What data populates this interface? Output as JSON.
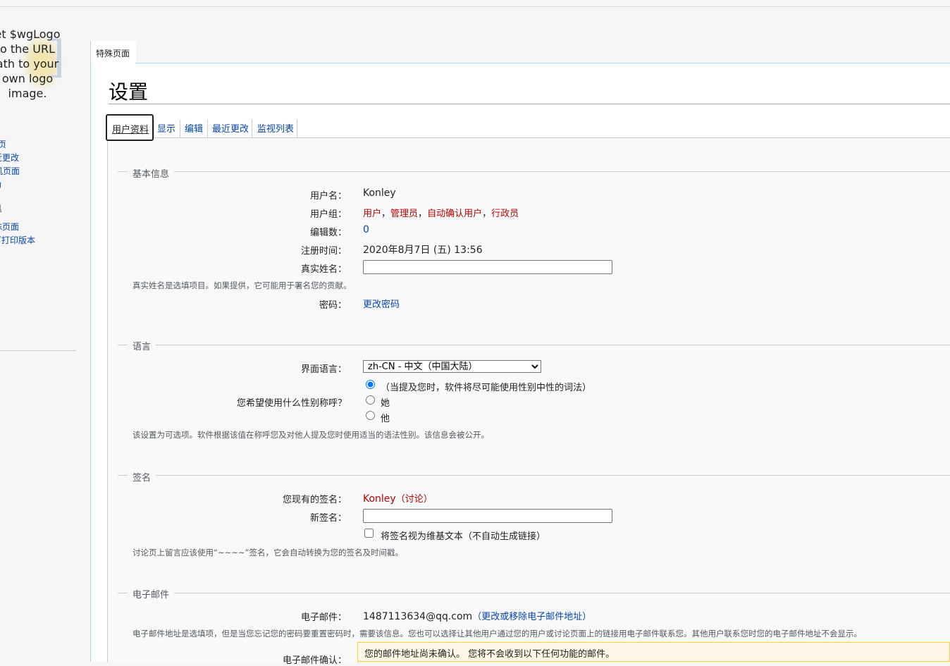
{
  "logo": {
    "text": "et $wgLogo\no the URL\nath to your\nown logo\nimage."
  },
  "sidebar": {
    "items": [
      {
        "label": "页"
      },
      {
        "label": "近更改"
      },
      {
        "label": "机页面"
      },
      {
        "label": "助"
      },
      {
        "label": "具"
      },
      {
        "label": "殊页面"
      },
      {
        "label": "可打印版本"
      }
    ]
  },
  "page_tab": {
    "label": "特殊页面"
  },
  "page": {
    "title": "设置"
  },
  "pref_tabs": [
    {
      "label": "用户资料",
      "selected": true
    },
    {
      "label": "显示"
    },
    {
      "label": "编辑"
    },
    {
      "label": "最近更改"
    },
    {
      "label": "监视列表"
    }
  ],
  "basic": {
    "legend": "基本信息",
    "username_label": "用户名：",
    "username": "Konley",
    "groups_label": "用户组：",
    "groups": [
      "用户",
      "管理员",
      "自动确认用户",
      "行政员"
    ],
    "groups_sep": "，",
    "edits_label": "编辑数：",
    "edits": "0",
    "registered_label": "注册时间：",
    "registered": "2020年8月7日 (五) 13:56",
    "realname_label": "真实姓名：",
    "realname_value": "",
    "realname_help": "真实姓名是选填项目。如果提供，它可能用于署名您的贡献。",
    "password_label": "密码：",
    "password_link": "更改密码"
  },
  "language": {
    "legend": "语言",
    "ui_lang_label": "界面语言：",
    "ui_lang_value": "zh-CN - 中文（中国大陆）",
    "gender_label": "您希望使用什么性别称呼？",
    "gender_options": [
      {
        "label": "（当提及您时，软件将尽可能使用性别中性的词法）",
        "checked": true
      },
      {
        "label": "她",
        "checked": false
      },
      {
        "label": "他",
        "checked": false
      }
    ],
    "gender_help": "该设置为可选项。软件根据该值在称呼您及对他人提及您时使用适当的语法性别。该信息会被公开。"
  },
  "signature": {
    "legend": "签名",
    "current_label": "您现有的签名：",
    "current_name": "Konley",
    "current_talk_open": "（",
    "current_talk": "讨论",
    "current_talk_close": "）",
    "new_label": "新签名：",
    "new_value": "",
    "raw_checkbox_label": "将签名视为维基文本（不自动生成链接）",
    "raw_checked": false,
    "help": "讨论页上留言应该使用“~~~~”签名，它会自动转换为您的签名及时间戳。"
  },
  "email": {
    "legend": "电子邮件",
    "address_label": "电子邮件：",
    "address": "1487113634@qq.com",
    "change_open": "（",
    "change_link": "更改或移除电子邮件地址",
    "change_close": "）",
    "help": "电子邮件地址是选填项，但是当您忘记您的密码要重置密码时，需要该信息。您也可以选择让其他用户通过您的用户或讨论页面上的链接用电子邮件联系您。其他用户联系您时您的电子邮件地址不会显示。",
    "confirm_label": "电子邮件确认：",
    "warning": "您的邮件地址尚未确认。 您将不会收到以下任何功能的邮件。"
  }
}
